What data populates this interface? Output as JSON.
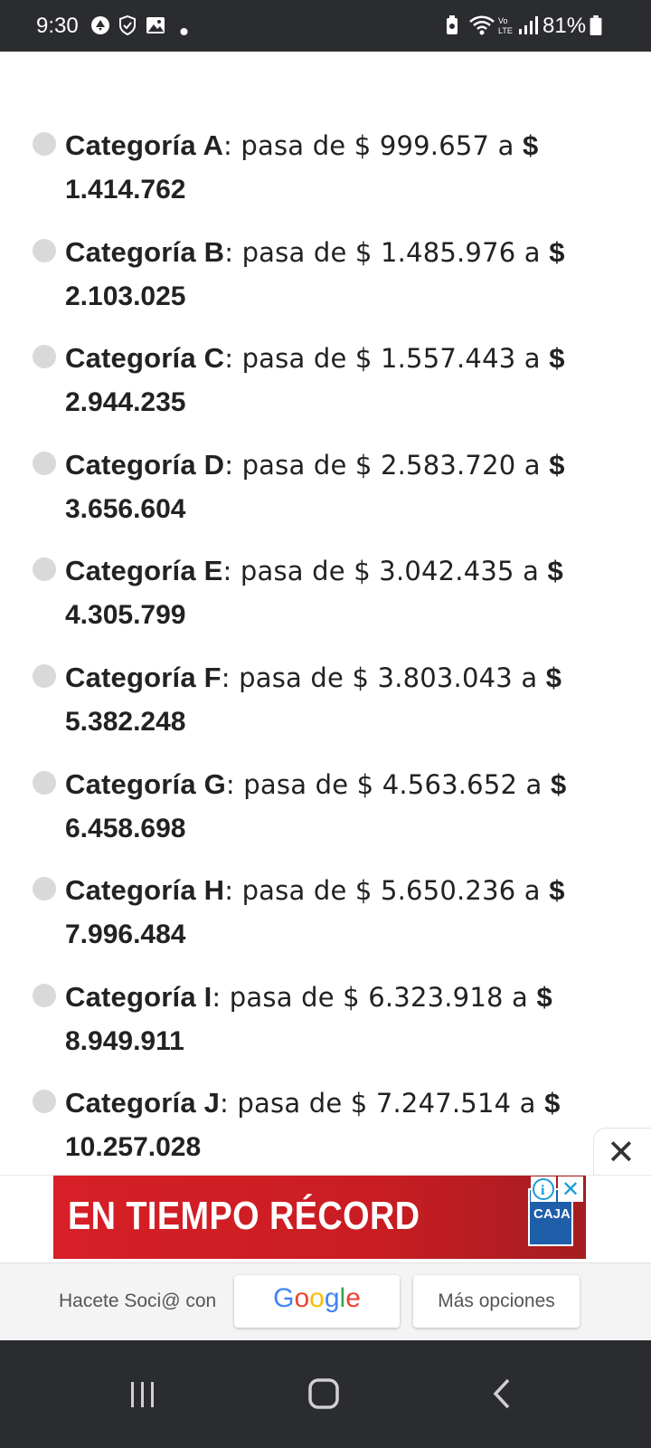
{
  "status_bar": {
    "time": "9:30",
    "battery_percent": "81%",
    "left_icons": [
      "data-saver-icon",
      "shield-icon",
      "image-icon",
      "dot-icon"
    ],
    "right_icons": [
      "battery-saver-icon",
      "wifi-icon",
      "volte-icon",
      "signal-icon",
      "battery-icon"
    ]
  },
  "categories": [
    {
      "name": "Categoría A",
      "text": ": pasa de $ 999.657 a ",
      "dollar": "$",
      "new_value": "1.414.762"
    },
    {
      "name": "Categoría B",
      "text": ": pasa de $ 1.485.976 a ",
      "dollar": "$",
      "new_value": "2.103.025"
    },
    {
      "name": "Categoría C",
      "text": ": pasa de $ 1.557.443 a ",
      "dollar": "$",
      "new_value": "2.944.235"
    },
    {
      "name": "Categoría D",
      "text": ": pasa de $ 2.583.720 a ",
      "dollar": "$",
      "new_value": "3.656.604"
    },
    {
      "name": "Categoría E",
      "text": ": pasa de $ 3.042.435 a ",
      "dollar": "$",
      "new_value": "4.305.799"
    },
    {
      "name": "Categoría F",
      "text": ": pasa de $ 3.803.043 a ",
      "dollar": "$",
      "new_value": "5.382.248"
    },
    {
      "name": "Categoría G",
      "text": ": pasa de $ 4.563.652 a ",
      "dollar": "$",
      "new_value": "6.458.698"
    },
    {
      "name": "Categoría H",
      "text": ": pasa de $ 5.650.236 a ",
      "dollar": "$",
      "new_value": "7.996.484"
    },
    {
      "name": "Categoría I",
      "text": ": pasa de $ 6.323.918 a ",
      "dollar": "$",
      "new_value": "8.949.911"
    },
    {
      "name": "Categoría J",
      "text": ": pasa de $ 7.247.514 a ",
      "dollar": "$",
      "new_value": "10.257.028"
    }
  ],
  "ad": {
    "headline": "EN TIEMPO RÉCORD",
    "logo_text": "CAJA",
    "close_symbol": "✕",
    "info_symbol": "i",
    "colors": {
      "background": "#d71f26",
      "logo": "#1f5faa",
      "adchoices": "#1a9bd7"
    }
  },
  "signin": {
    "prompt": "Hacete Soci@ con",
    "google_label": "Google",
    "more_options": "Más opciones",
    "google_colors": [
      "#4285F4",
      "#EA4335",
      "#FBBC05",
      "#4285F4",
      "#34A853",
      "#EA4335"
    ]
  },
  "nav": {
    "icons": [
      "recents-icon",
      "home-icon",
      "back-icon"
    ]
  }
}
